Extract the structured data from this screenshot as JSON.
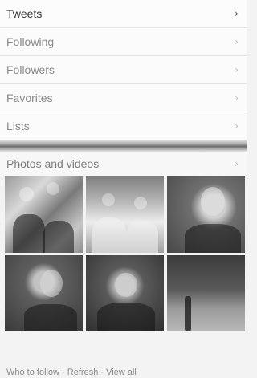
{
  "nav": {
    "items": [
      {
        "label": "Tweets",
        "active": true
      },
      {
        "label": "Following",
        "active": false
      },
      {
        "label": "Followers",
        "active": false
      },
      {
        "label": "Favorites",
        "active": false
      },
      {
        "label": "Lists",
        "active": false
      }
    ],
    "chevron": "›"
  },
  "media": {
    "header": "Photos and videos",
    "chevron": "›",
    "thumbnails": [
      {
        "icon": "photo-crowd-celebration"
      },
      {
        "icon": "photo-football-players-19-10"
      },
      {
        "icon": "photo-player-portrait-sooners"
      },
      {
        "icon": "photo-player-interview-ou"
      },
      {
        "icon": "photo-coach-press-conference"
      },
      {
        "icon": "photo-stadium-field"
      }
    ]
  },
  "footer": {
    "text": "Who to follow · Refresh · View all"
  }
}
